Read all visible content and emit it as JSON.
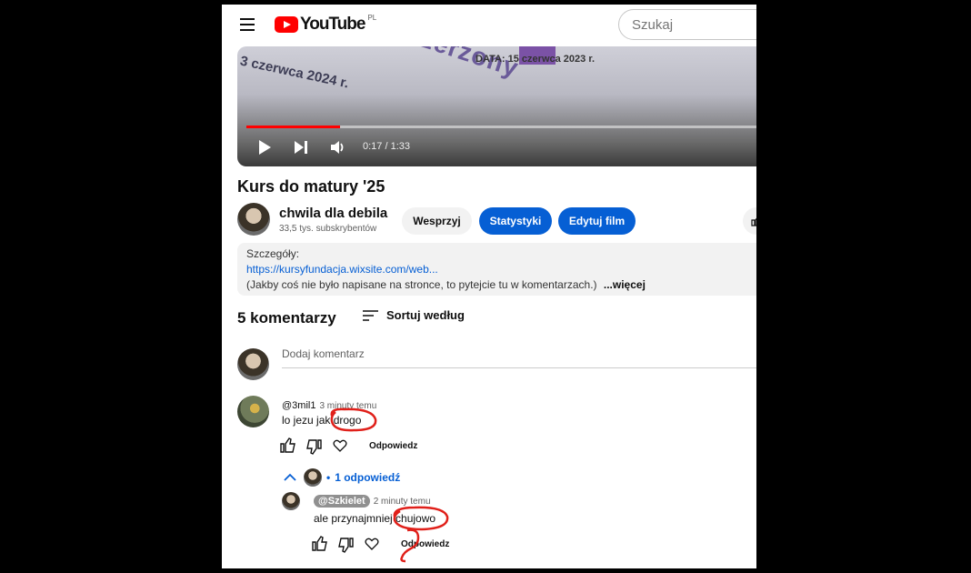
{
  "header": {
    "logo_text": "YouTube",
    "country_code": "PL",
    "search_placeholder": "Szukaj"
  },
  "video": {
    "overlay_text_1": "3 czerwca 2024 r.",
    "overlay_text_2": "DATA: 15 czerwca 2023 r.",
    "overlay_text_3": "zerzony",
    "time": "0:17 / 1:33",
    "progress": 0.183
  },
  "title": "Kurs do matury '25",
  "channel": {
    "name": "chwila dla debila",
    "subscribers": "33,5 tys. subskrybentów",
    "support_label": "Wesprzyj",
    "stats_label": "Statystyki",
    "edit_label": "Edytuj film"
  },
  "description": {
    "label": "Szczegóły:",
    "link": "https://kursyfundacja.wixsite.com/web...",
    "text": "(Jakby coś nie było napisane na stronce, to pytejcie tu w komentarzach.)",
    "more": "...więcej"
  },
  "comments": {
    "count": "5 komentarzy",
    "sort_label": "Sortuj według",
    "add_placeholder": "Dodaj komentarz",
    "reply_label": "Odpowiedz",
    "replies_toggle": "1 odpowiedź",
    "items": [
      {
        "author": "@3mil1",
        "ago": "3 minuty temu",
        "text": "lo jezu jak drogo"
      }
    ],
    "reply": {
      "author": "@Szkielet",
      "ago": "2 minuty temu",
      "text": "ale przynajmniej chujowo"
    }
  },
  "colors": {
    "accent": "#065fd4",
    "brand": "#ff0000",
    "annotation": "#e0201a"
  }
}
